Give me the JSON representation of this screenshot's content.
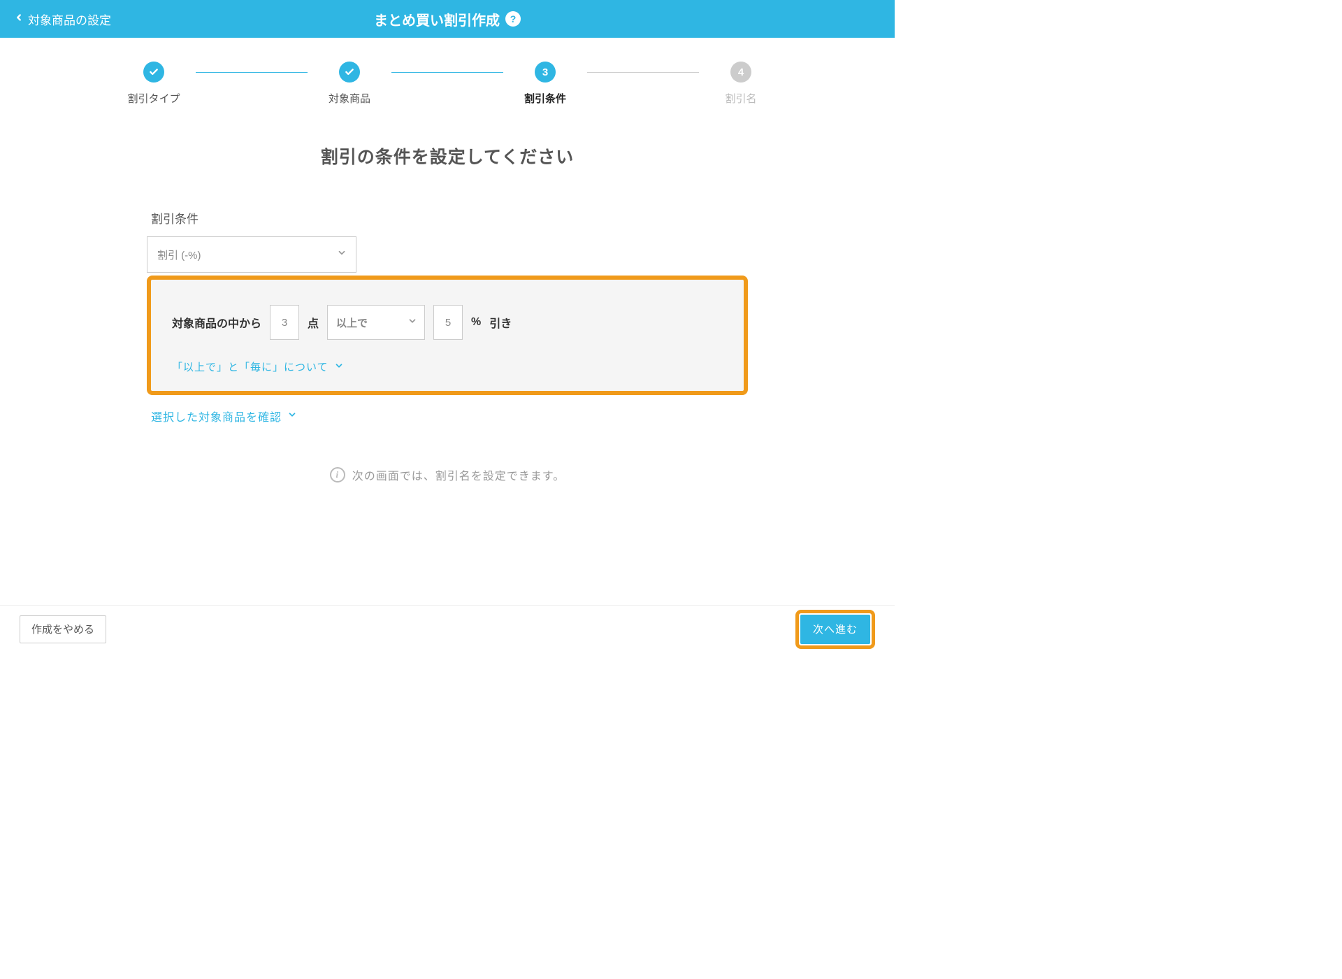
{
  "header": {
    "back_label": "対象商品の設定",
    "title": "まとめ買い割引作成",
    "help_badge": "?"
  },
  "stepper": {
    "items": [
      {
        "label": "割引タイプ",
        "state": "done"
      },
      {
        "label": "対象商品",
        "state": "done"
      },
      {
        "label": "割引条件",
        "state": "active",
        "number": "3"
      },
      {
        "label": "割引名",
        "state": "pending",
        "number": "4"
      }
    ]
  },
  "main": {
    "section_title": "割引の条件を設定してください",
    "condition_label": "割引条件",
    "discount_type_value": "割引 (-%)",
    "row": {
      "text_prefix": "対象商品の中から",
      "qty_value": "3",
      "unit_label": "点",
      "operator_value": "以上で",
      "pct_value": "5",
      "pct_symbol": "%",
      "suffix_label": "引き"
    },
    "panel_help_link": "「以上で」と「毎に」について",
    "confirm_link": "選択した対象商品を確認",
    "info_text": "次の画面では、割引名を設定できます。",
    "info_badge": "i"
  },
  "footer": {
    "cancel_label": "作成をやめる",
    "next_label": "次へ進む"
  },
  "colors": {
    "primary": "#2FB6E3",
    "highlight": "#F09A1A"
  }
}
